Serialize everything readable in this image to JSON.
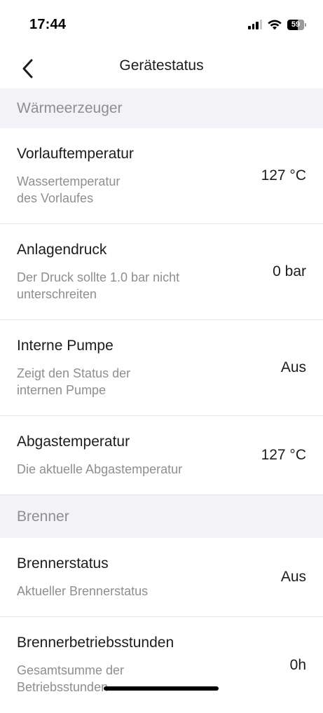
{
  "status_bar": {
    "time": "17:44",
    "battery": "59",
    "icons": [
      "cellular-signal-icon",
      "wifi-icon",
      "battery-icon"
    ]
  },
  "nav": {
    "title": "Gerätestatus",
    "back_icon": "chevron-left-icon"
  },
  "sections": [
    {
      "header": "Wärmeerzeuger",
      "rows": [
        {
          "title": "Vorlauftemperatur",
          "subtitle": "Wassertemperatur\ndes Vorlaufes",
          "value": "127 °C"
        },
        {
          "title": "Anlagendruck",
          "subtitle": "Der Druck sollte 1.0 bar nicht unterschreiten",
          "value": "0 bar"
        },
        {
          "title": "Interne Pumpe",
          "subtitle": "Zeigt den Status der internen Pumpe",
          "value": "Aus"
        },
        {
          "title": "Abgastemperatur",
          "subtitle": "Die aktuelle Abgastemperatur",
          "value": "127 °C"
        }
      ]
    },
    {
      "header": "Brenner",
      "rows": [
        {
          "title": "Brennerstatus",
          "subtitle": "Aktueller Brennerstatus",
          "value": "Aus"
        },
        {
          "title": "Brennerbetriebsstunden",
          "subtitle": "Gesamtsumme der Betriebsstunden",
          "value": "0h"
        }
      ]
    }
  ]
}
